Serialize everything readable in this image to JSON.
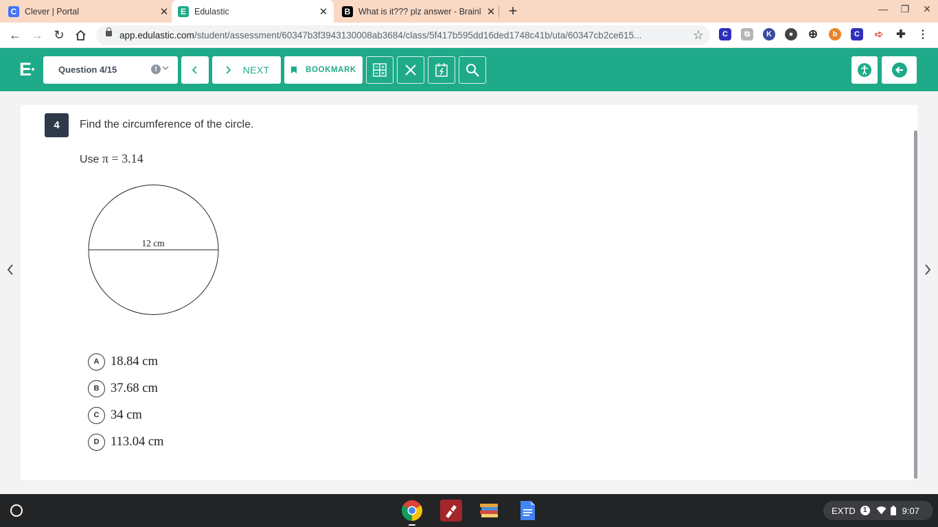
{
  "browser": {
    "tabs": [
      {
        "title": "Clever | Portal",
        "favicon": "C",
        "favicon_color": "#4274f6"
      },
      {
        "title": "Edulastic",
        "favicon": "E",
        "favicon_color": "#1fab89"
      },
      {
        "title": "What is it??? plz answer - Brainly",
        "favicon": "B",
        "favicon_color": "#000000"
      }
    ],
    "url_host": "app.edulastic.com",
    "url_path": "/student/assessment/60347b3f3943130008ab3684/class/5f417b595dd16ded1748c41b/uta/60347cb2ce615..."
  },
  "header": {
    "logo": "E",
    "question_selector": "Question 4/15",
    "next_label": "NEXT",
    "bookmark_label": "BOOKMARK",
    "accent_color": "#1fab89"
  },
  "question": {
    "number": "4",
    "text": "Find the circumference of the circle.",
    "hint_prefix": "Use ",
    "hint_math": "π = 3.14",
    "diagram_label": "12 cm",
    "options": [
      {
        "letter": "A",
        "text": "18.84 cm"
      },
      {
        "letter": "B",
        "text": "37.68 cm"
      },
      {
        "letter": "C",
        "text": "34 cm"
      },
      {
        "letter": "D",
        "text": "113.04 cm"
      }
    ]
  },
  "shelf": {
    "display_mode": "EXTD",
    "notification_count": "1",
    "time": "9:07"
  }
}
